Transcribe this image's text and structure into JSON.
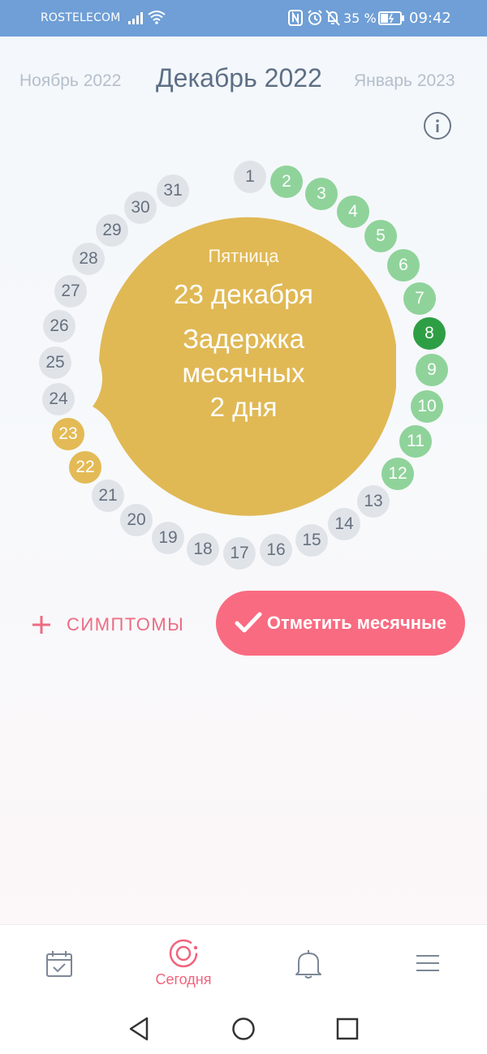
{
  "status_bar": {
    "carrier": "ROSTELECOM",
    "battery_percent": "35 %",
    "time": "09:42",
    "icons": [
      "signal-icon",
      "wifi-icon",
      "nfc-icon",
      "alarm-icon",
      "mute-icon",
      "battery-icon"
    ]
  },
  "header": {
    "prev_month": "Ноябрь 2022",
    "current_month": "Декабрь 2022",
    "next_month": "Январь 2023",
    "info_icon": "info-icon"
  },
  "cycle": {
    "days": [
      {
        "label": "1",
        "state": "normal"
      },
      {
        "label": "2",
        "state": "fertile"
      },
      {
        "label": "3",
        "state": "fertile"
      },
      {
        "label": "4",
        "state": "fertile"
      },
      {
        "label": "5",
        "state": "fertile"
      },
      {
        "label": "6",
        "state": "fertile"
      },
      {
        "label": "7",
        "state": "fertile"
      },
      {
        "label": "8",
        "state": "ovulation"
      },
      {
        "label": "9",
        "state": "fertile"
      },
      {
        "label": "10",
        "state": "fertile"
      },
      {
        "label": "11",
        "state": "fertile"
      },
      {
        "label": "12",
        "state": "fertile"
      },
      {
        "label": "13",
        "state": "normal"
      },
      {
        "label": "14",
        "state": "normal"
      },
      {
        "label": "15",
        "state": "normal"
      },
      {
        "label": "16",
        "state": "normal"
      },
      {
        "label": "17",
        "state": "normal"
      },
      {
        "label": "18",
        "state": "normal"
      },
      {
        "label": "19",
        "state": "normal"
      },
      {
        "label": "20",
        "state": "normal"
      },
      {
        "label": "21",
        "state": "normal"
      },
      {
        "label": "22",
        "state": "delay"
      },
      {
        "label": "23",
        "state": "delay"
      },
      {
        "label": "24",
        "state": "normal"
      },
      {
        "label": "25",
        "state": "normal"
      },
      {
        "label": "26",
        "state": "normal"
      },
      {
        "label": "27",
        "state": "normal"
      },
      {
        "label": "28",
        "state": "normal"
      },
      {
        "label": "29",
        "state": "normal"
      },
      {
        "label": "30",
        "state": "normal"
      },
      {
        "label": "31",
        "state": "normal"
      }
    ],
    "selected_day": "23",
    "bubble": {
      "weekday": "Пятница",
      "date": "23 декабря",
      "status_lines": [
        "Задержка",
        "месячных",
        "2 дня"
      ]
    }
  },
  "actions": {
    "symptoms_label": "СИМПТОМЫ",
    "mark_period_label": "Отметить месячные"
  },
  "bottom_nav": {
    "items": [
      {
        "icon": "calendar-icon",
        "label": ""
      },
      {
        "icon": "today-icon",
        "label": "Сегодня",
        "active": true
      },
      {
        "icon": "bell-icon",
        "label": ""
      },
      {
        "icon": "menu-icon",
        "label": ""
      }
    ]
  },
  "colors": {
    "status_bar": "#6f9fd6",
    "accent": "#f96b81",
    "fertile": "#8fd39a",
    "ovulation": "#2e9e45",
    "delay": "#e3ba55",
    "bubble": "#e0b955",
    "day_default": "#e0e4e9"
  }
}
